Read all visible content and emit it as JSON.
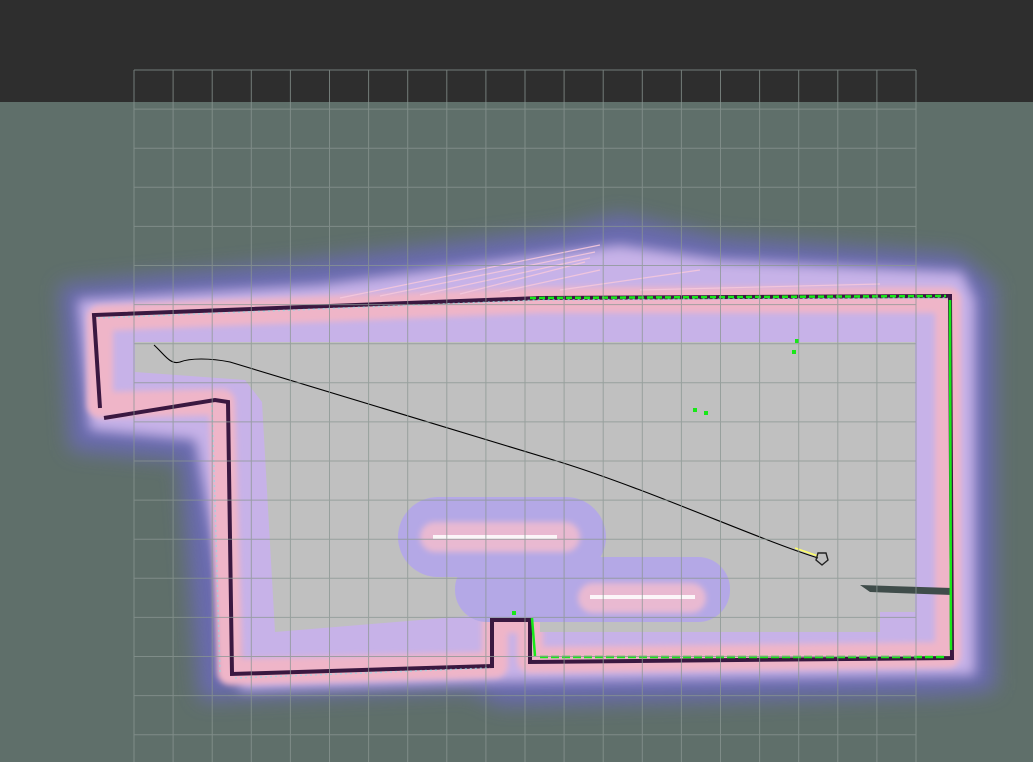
{
  "app": {
    "title": ""
  },
  "colors": {
    "background": "#5f6f6a",
    "toolbar": "#2e2e2e",
    "grid_line": "#8a9692",
    "free_space": "#c0c0c0",
    "inflation_outer": "#6a6ab4",
    "inflation_inner": "#c8b4e8",
    "inflation_core": "#f0b4c8",
    "obstacle": "#3a1840",
    "laser_scan": "#00ff00",
    "path": "#000000",
    "local_plan": "#ffff66",
    "robot_footprint": "#222222"
  },
  "map": {
    "grid_visible": true,
    "layers": [
      "occupancy-map",
      "costmap-inflation",
      "laser-scan",
      "global-path",
      "robot-footprint"
    ]
  }
}
